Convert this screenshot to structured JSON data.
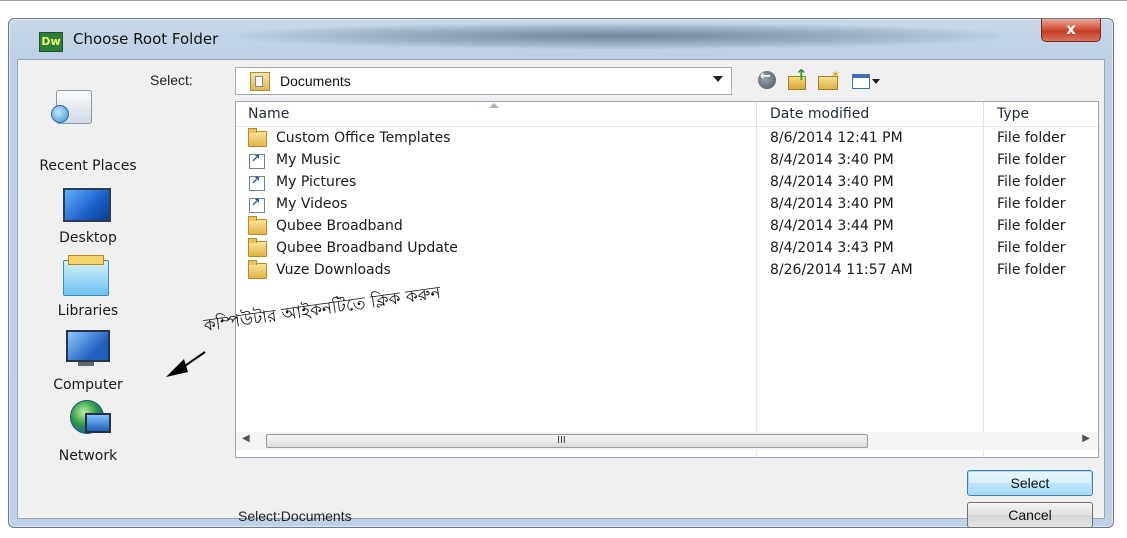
{
  "window": {
    "app_icon_text": "Dw",
    "title": "Choose Root Folder",
    "close_label": "x"
  },
  "toolbar": {
    "select_label": "Select:",
    "location_value": "Documents",
    "icons": [
      "back-icon",
      "up-folder-icon",
      "new-folder-icon",
      "views-menu-icon"
    ]
  },
  "places": [
    {
      "label": "Recent Places",
      "icon": "recent-places-icon"
    },
    {
      "label": "Desktop",
      "icon": "desktop-icon"
    },
    {
      "label": "Libraries",
      "icon": "libraries-icon"
    },
    {
      "label": "Computer",
      "icon": "computer-icon"
    },
    {
      "label": "Network",
      "icon": "network-icon"
    }
  ],
  "file_list": {
    "columns": [
      "Name",
      "Date modified",
      "Type"
    ],
    "rows": [
      {
        "name": "Custom Office Templates",
        "date": "8/6/2014 12:41 PM",
        "type": "File folder",
        "icon": "folder-icon"
      },
      {
        "name": "My Music",
        "date": "8/4/2014 3:40 PM",
        "type": "File folder",
        "icon": "shortcut-icon"
      },
      {
        "name": "My Pictures",
        "date": "8/4/2014 3:40 PM",
        "type": "File folder",
        "icon": "shortcut-icon"
      },
      {
        "name": "My Videos",
        "date": "8/4/2014 3:40 PM",
        "type": "File folder",
        "icon": "shortcut-icon"
      },
      {
        "name": "Qubee Broadband",
        "date": "8/4/2014 3:44 PM",
        "type": "File folder",
        "icon": "folder-icon"
      },
      {
        "name": "Qubee Broadband Update",
        "date": "8/4/2014 3:43 PM",
        "type": "File folder",
        "icon": "folder-icon"
      },
      {
        "name": "Vuze Downloads",
        "date": "8/26/2014 11:57 AM",
        "type": "File folder",
        "icon": "folder-icon"
      }
    ],
    "scroll_grip": "III"
  },
  "status": {
    "text": "Select:Documents"
  },
  "buttons": {
    "select": "Select",
    "cancel": "Cancel"
  },
  "annotation": {
    "text": "কম্পিউটার আইকনটিতে ক্লিক করুন"
  },
  "colors": {
    "frame": "#bcd0e6",
    "close": "#c33c25",
    "select_button": "#bee6fd"
  }
}
